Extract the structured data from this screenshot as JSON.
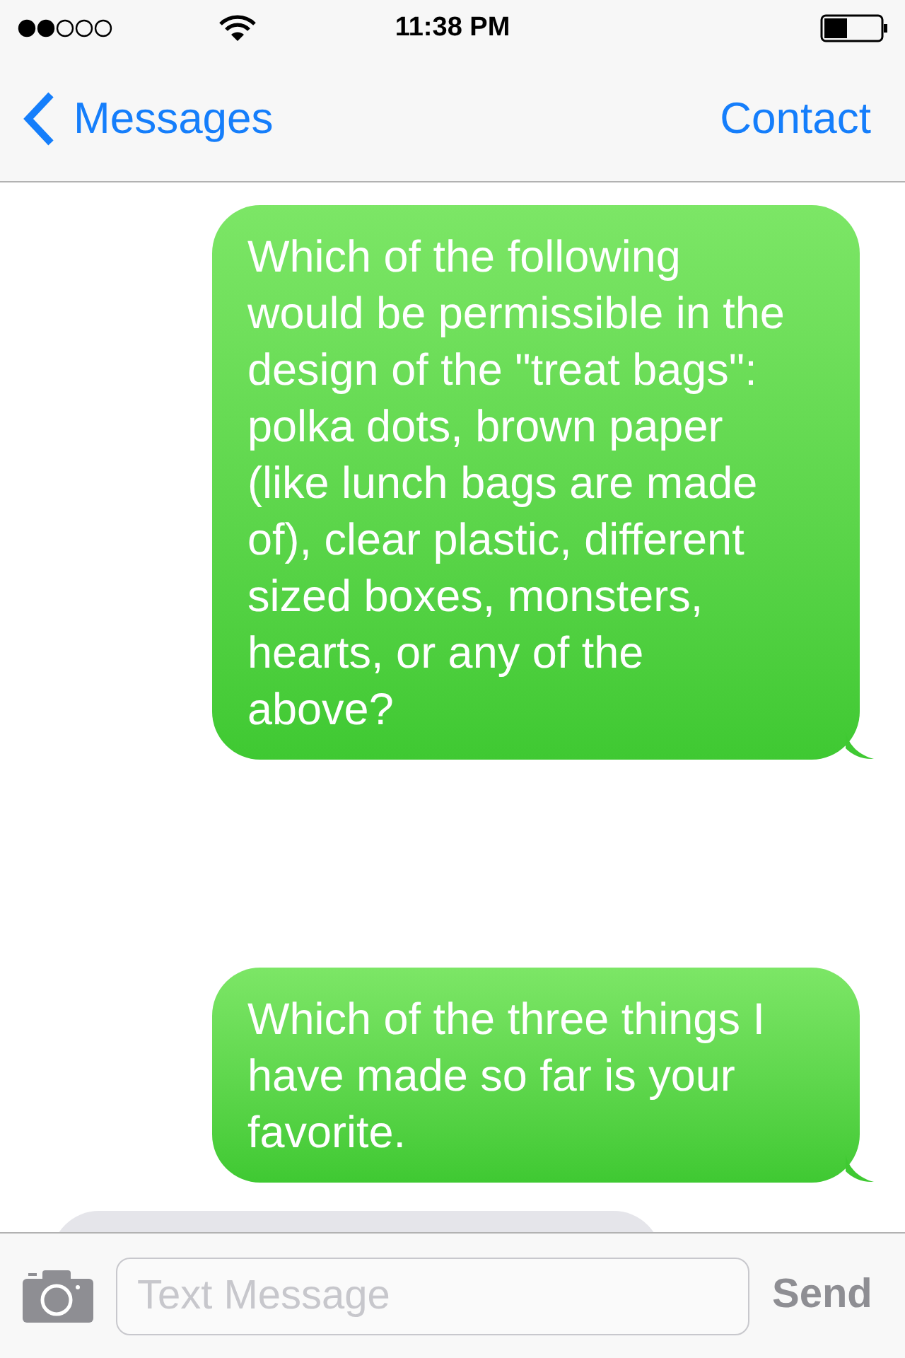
{
  "status_bar": {
    "time": "11:38 PM"
  },
  "nav": {
    "back_label": "Messages",
    "action": "Contact"
  },
  "messages": [
    {
      "kind": "sent",
      "text": "Which of the following would be permissible in the design of the \"treat bags\": polka dots, brown paper (like lunch bags are made of), clear plastic, different sized boxes, monsters, hearts, or any of the above?"
    },
    {
      "kind": "sent",
      "text": "Which of the three things I have made so far is your favorite."
    }
  ],
  "compose": {
    "placeholder": "Text Message",
    "send": {
      "label": "Send",
      "disabled": true
    }
  }
}
